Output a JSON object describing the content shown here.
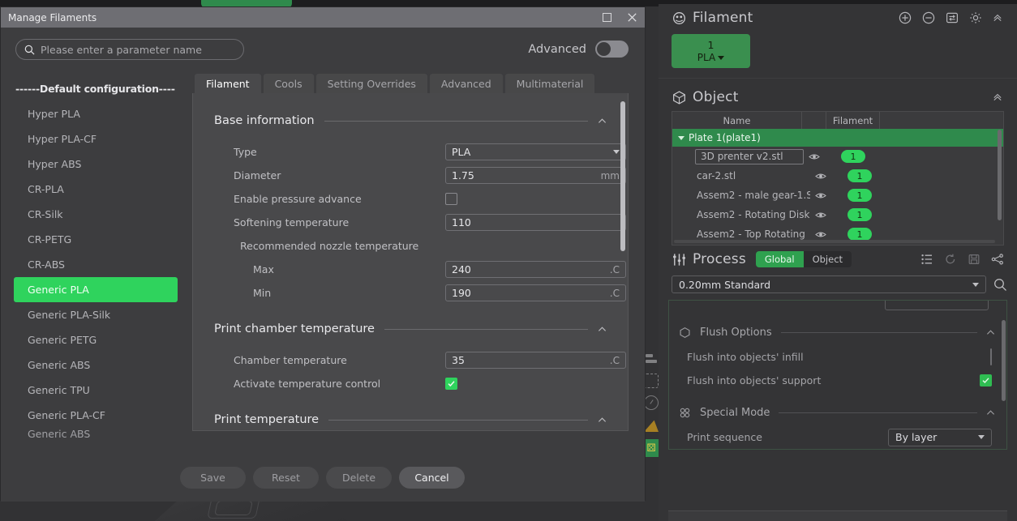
{
  "window": {
    "title": "Manage Filaments",
    "maximize_icon": "maximize-icon",
    "close_icon": "close-icon"
  },
  "search": {
    "placeholder": "Please enter a parameter name",
    "icon": "search-icon"
  },
  "advanced": {
    "label": "Advanced",
    "state": "off"
  },
  "presets": {
    "header": "------Default configuration----",
    "selected": "Generic PLA",
    "items": [
      "Hyper PLA",
      "Hyper PLA-CF",
      "Hyper ABS",
      "CR-PLA",
      "CR-Silk",
      "CR-PETG",
      "CR-ABS",
      "Generic PLA",
      "Generic PLA-Silk",
      "Generic PETG",
      "Generic ABS",
      "Generic TPU",
      "Generic PLA-CF",
      "Generic ABS"
    ]
  },
  "tabs": [
    {
      "label": "Filament",
      "active": true
    },
    {
      "label": "Cools",
      "active": false
    },
    {
      "label": "Setting Overrides",
      "active": false
    },
    {
      "label": "Advanced",
      "active": false
    },
    {
      "label": "Multimaterial",
      "active": false
    }
  ],
  "groups": {
    "base_information": {
      "title": "Base information",
      "fields": {
        "type": {
          "label": "Type",
          "value": "PLA"
        },
        "diameter": {
          "label": "Diameter",
          "value": "1.75",
          "unit": "mm"
        },
        "pressure_advance": {
          "label": "Enable pressure advance",
          "checked": false
        },
        "softening": {
          "label": "Softening temperature",
          "value": "110"
        },
        "recommended": {
          "label": "Recommended nozzle temperature"
        },
        "max": {
          "label": "Max",
          "value": "240",
          "unit": ".C"
        },
        "min": {
          "label": "Min",
          "value": "190",
          "unit": ".C"
        }
      }
    },
    "print_chamber": {
      "title": "Print chamber temperature",
      "fields": {
        "chamber_temp": {
          "label": "Chamber temperature",
          "value": "35",
          "unit": ".C"
        },
        "activate": {
          "label": "Activate temperature control",
          "checked": true
        }
      }
    },
    "print_temperature": {
      "title": "Print temperature"
    }
  },
  "footer": {
    "save": "Save",
    "reset": "Reset",
    "delete": "Delete",
    "cancel": "Cancel"
  },
  "sidepanel": {
    "filament": {
      "title": "Filament",
      "icon": "filament-spool-icon",
      "actions": [
        "add-icon",
        "remove-icon",
        "sync-icon",
        "gear-icon",
        "collapse-icon"
      ],
      "chips": [
        {
          "number": "1",
          "type": "PLA"
        }
      ]
    },
    "object": {
      "title": "Object",
      "icon": "cube-icon",
      "columns": [
        "Name",
        "",
        "Filament",
        ""
      ],
      "plate": "Plate 1(plate1)",
      "rows": [
        {
          "name": "3D prenter v2.stl",
          "filament": "1",
          "editing": true
        },
        {
          "name": "car-2.stl",
          "filament": "1",
          "editing": false
        },
        {
          "name": "Assem2 - male gear-1.S",
          "filament": "1",
          "editing": false
        },
        {
          "name": "Assem2 - Rotating Disk",
          "filament": "1",
          "editing": false
        },
        {
          "name": "Assem2 - Top Rotating",
          "filament": "1",
          "editing": false
        }
      ]
    },
    "process": {
      "title": "Process",
      "icon": "sliders-icon",
      "segments": [
        {
          "label": "Global",
          "active": true
        },
        {
          "label": "Object",
          "active": false
        }
      ],
      "actions": [
        "list-icon",
        "reset-icon",
        "save-icon",
        "compare-icon"
      ],
      "preset": "0.20mm Standard",
      "search_icon": "search-icon",
      "groups": [
        {
          "title": "Flush Options",
          "icon": "cube-outline-icon",
          "rows": [
            {
              "label": "Flush into objects' infill",
              "type": "checkbox",
              "checked": false
            },
            {
              "label": "Flush into objects' support",
              "type": "checkbox",
              "checked": true
            }
          ]
        },
        {
          "title": "Special Mode",
          "icon": "special-mode-icon",
          "rows": [
            {
              "label": "Print sequence",
              "type": "dropdown",
              "value": "By layer"
            }
          ]
        }
      ]
    }
  },
  "colors": {
    "accent_green": "#2fd35d",
    "header_green": "#2f8a4c",
    "dialog_bg": "#3d3d3f",
    "panel_bg": "#49494b",
    "side_bg": "#343436"
  }
}
